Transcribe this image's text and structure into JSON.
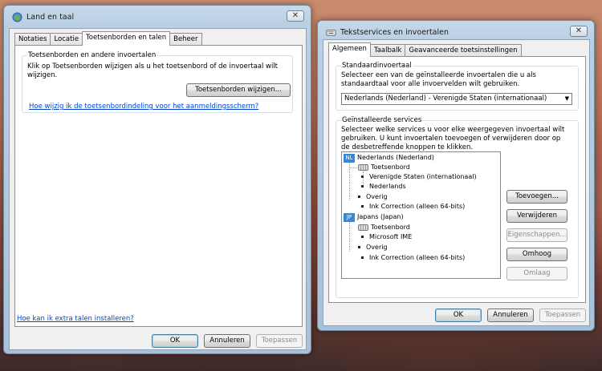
{
  "window1": {
    "title": "Land en taal",
    "tabs": [
      "Notaties",
      "Locatie",
      "Toetsenborden en talen",
      "Beheer"
    ],
    "group_title": "Toetsenborden en andere invoertalen",
    "group_text": "Klik op Toetsenborden wijzigen als u het toetsenbord of de invoertaal wilt wijzigen.",
    "change_button": "Toetsenborden wijzigen...",
    "login_link": "Hoe wijzig ik de toetsenbordindeling voor het aanmeldingsscherm?",
    "install_link": "Hoe kan ik extra talen installeren?",
    "ok": "OK",
    "cancel": "Annuleren",
    "apply": "Toepassen",
    "close": "✕"
  },
  "window2": {
    "title": "Tekstservices en invoertalen",
    "tabs": [
      "Algemeen",
      "Taalbalk",
      "Geavanceerde toetsinstellingen"
    ],
    "default_group_title": "Standaardinvoertaal",
    "default_text": "Selecteer een van de geïnstalleerde invoertalen die u als standaardtaal voor alle invoervelden wilt gebruiken.",
    "default_value": "Nederlands (Nederland) - Verenigde Staten (internationaal)",
    "installed_group_title": "Geïnstalleerde services",
    "installed_text": "Selecteer welke services u voor elke weergegeven invoertaal wilt gebruiken. U kunt invoertalen toevoegen of verwijderen door op de desbetreffende knoppen te klikken.",
    "tree": {
      "nl_badge": "NL",
      "nl_label": "Nederlands (Nederland)",
      "nl_keyboard": "Toetsenbord",
      "nl_kb1": "Verenigde Staten (internationaal)",
      "nl_kb2": "Nederlands",
      "nl_other": "Overig",
      "nl_ink": "Ink Correction (alleen 64-bits)",
      "jp_badge": "JP",
      "jp_label": "Japans (Japan)",
      "jp_keyboard": "Toetsenbord",
      "jp_kb1": "Microsoft IME",
      "jp_other": "Overig",
      "jp_ink": "Ink Correction (alleen 64-bits)"
    },
    "add": "Toevoegen...",
    "remove": "Verwijderen",
    "properties": "Eigenschappen...",
    "up": "Omhoog",
    "down": "Omlaag",
    "ok": "OK",
    "cancel": "Annuleren",
    "apply": "Toepassen",
    "close": "✕"
  }
}
